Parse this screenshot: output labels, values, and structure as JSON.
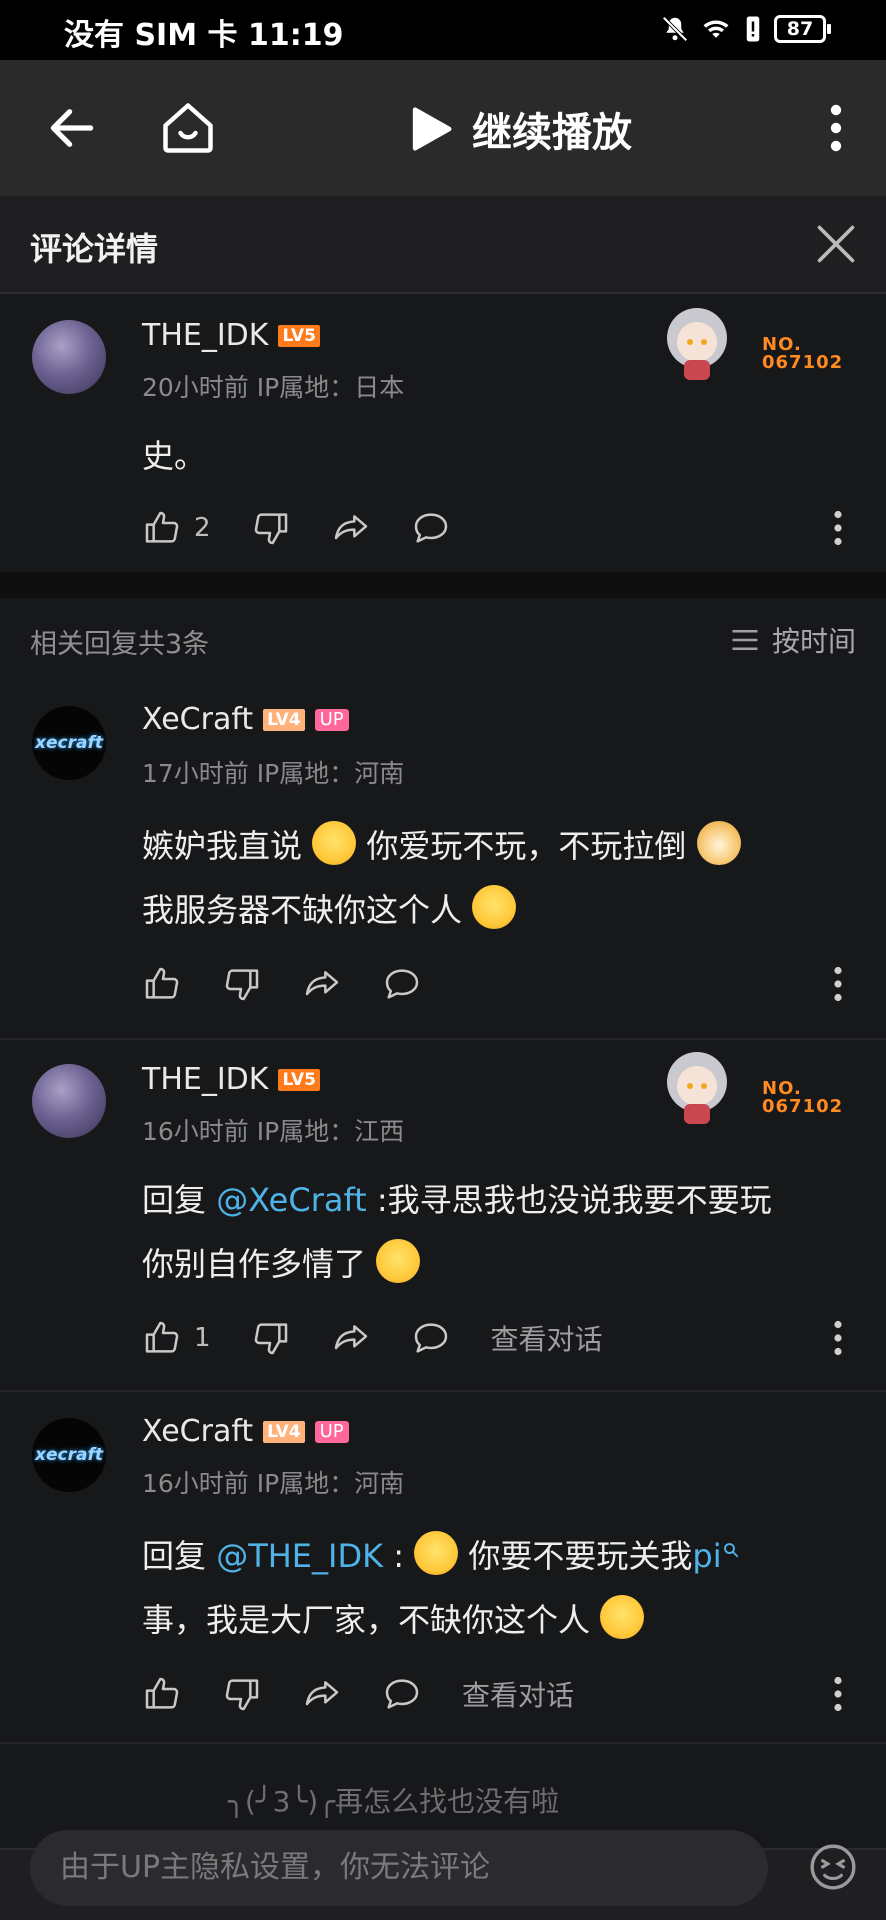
{
  "status_bar": {
    "carrier_time": "没有 SIM 卡 11:19",
    "battery": "87",
    "icons": [
      "mute-bell-icon",
      "wifi-icon",
      "alert-icon",
      "battery-icon"
    ]
  },
  "nav": {
    "back_icon": "back-arrow-icon",
    "home_icon": "home-icon",
    "play_label": "继续播放",
    "more_icon": "more-vert-icon"
  },
  "detail": {
    "title": "评论详情",
    "close_icon": "close-icon"
  },
  "main_comment": {
    "user": "THE_IDK",
    "level": "LV5",
    "meta": "20小时前 IP属地：日本",
    "text": "史。",
    "likes": "2",
    "fan_no": "NO.\n067102"
  },
  "related": {
    "header": "相关回复共3条",
    "sort_label": "按时间"
  },
  "replies": [
    {
      "user": "XeCraft",
      "level": "LV4",
      "badge": "UP",
      "meta": "17小时前 IP属地：河南",
      "line1": "嫉妒我直说",
      "line1b": "你爱玩不玩，不玩拉倒",
      "line2": "我服务器不缺你这个人",
      "likes": ""
    },
    {
      "user": "THE_IDK",
      "level": "LV5",
      "meta": "16小时前 IP属地：江西",
      "reply_prefix": "回复",
      "mention": "@XeCraft",
      "line1": ":我寻思我也没说我要不要玩",
      "line2": "你别自作多情了",
      "likes": "1",
      "convo": "查看对话",
      "fan_no": "NO.\n067102"
    },
    {
      "user": "XeCraft",
      "level": "LV4",
      "badge": "UP",
      "meta": "16小时前 IP属地：河南",
      "reply_prefix": "回复",
      "mention": "@THE_IDK",
      "colon": ":",
      "line1": "你要不要玩关我",
      "link": "pi",
      "line2": "事，我是大厂家，不缺你这个人",
      "convo": "查看对话"
    }
  ],
  "end_text": "╮(╯3╰)╭再怎么找也没有啦",
  "footer": {
    "input_placeholder": "由于UP主隐私设置，你无法评论",
    "emoji_icon": "emoji-face-icon"
  }
}
